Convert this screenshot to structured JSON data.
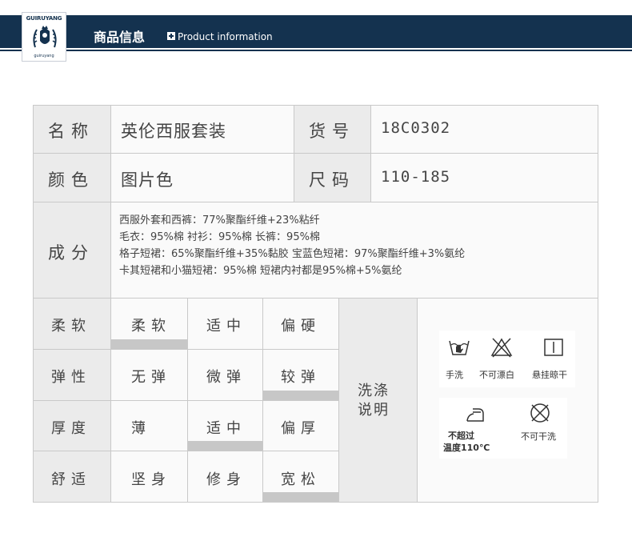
{
  "header": {
    "logo_brand": "GUIRUYANG",
    "logo_tagline": "guiruyang",
    "title_cn": "商品信息",
    "title_en": "Product information"
  },
  "info": {
    "name_label": "名称",
    "name_value": "英伦西服套装",
    "sku_label": "货号",
    "sku_value": "18C0302",
    "color_label": "颜色",
    "color_value": "图片色",
    "size_label": "尺码",
    "size_value": "110-185",
    "composition_label": "成分",
    "composition_lines": [
      "西服外套和西裤：77%聚酯纤维+23%粘纤",
      "毛衣：95%棉  衬衫：95%棉  长裤：95%棉",
      "格子短裙：65%聚酯纤维+35%黏胶  宝蓝色短裙：97%聚酯纤维+3%氨纶",
      "卡其短裙和小猫短裙：95%棉     短裙内衬都是95%棉+5%氨纶"
    ]
  },
  "attributes": [
    {
      "label": "柔软",
      "options": [
        "柔软",
        "适中",
        "偏硬"
      ],
      "selected": 0
    },
    {
      "label": "弹性",
      "options": [
        "无弹",
        "微弹",
        "较弹"
      ],
      "selected": 2
    },
    {
      "label": "厚度",
      "options": [
        "薄",
        "适中",
        "偏厚"
      ],
      "selected": 1
    },
    {
      "label": "舒适",
      "options": [
        "坚身",
        "修身",
        "宽松"
      ],
      "selected": 2
    }
  ],
  "care": {
    "title_line1": "洗涤",
    "title_line2": "说明",
    "icons": [
      {
        "icon": "hand-wash-icon",
        "label": "手洗"
      },
      {
        "icon": "no-bleach-icon",
        "label": "不可漂白"
      },
      {
        "icon": "hang-dry-icon",
        "label": "悬挂晾干"
      },
      {
        "icon": "iron-icon",
        "label_line1": "不超过",
        "label_line2": "温度110℃"
      },
      {
        "icon": "no-dry-clean-icon",
        "label": "不可干洗"
      }
    ]
  }
}
